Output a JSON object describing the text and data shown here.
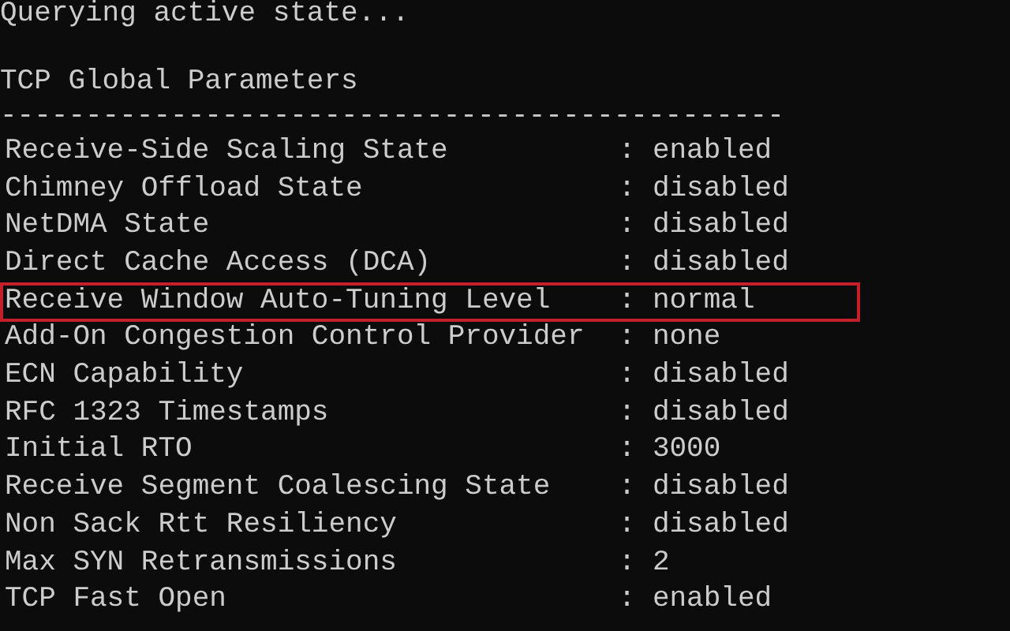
{
  "console": {
    "status_line": "Querying active state...",
    "heading": "TCP Global Parameters",
    "separator": "----------------------------------------------",
    "rows": [
      {
        "name": "Receive-Side Scaling State",
        "separator": ":",
        "value": "enabled",
        "highlighted": false
      },
      {
        "name": "Chimney Offload State",
        "separator": ":",
        "value": "disabled",
        "highlighted": false
      },
      {
        "name": "NetDMA State",
        "separator": ":",
        "value": "disabled",
        "highlighted": false
      },
      {
        "name": "Direct Cache Access (DCA)",
        "separator": ":",
        "value": "disabled",
        "highlighted": false
      },
      {
        "name": "Receive Window Auto-Tuning Level",
        "separator": ":",
        "value": "normal",
        "highlighted": true
      },
      {
        "name": "Add-On Congestion Control Provider",
        "separator": ":",
        "value": "none",
        "highlighted": false
      },
      {
        "name": "ECN Capability",
        "separator": ":",
        "value": "disabled",
        "highlighted": false
      },
      {
        "name": "RFC 1323 Timestamps",
        "separator": ":",
        "value": "disabled",
        "highlighted": false
      },
      {
        "name": "Initial RTO",
        "separator": ":",
        "value": "3000",
        "highlighted": false
      },
      {
        "name": "Receive Segment Coalescing State",
        "separator": ":",
        "value": "disabled",
        "highlighted": false
      },
      {
        "name": "Non Sack Rtt Resiliency",
        "separator": ":",
        "value": "disabled",
        "highlighted": false
      },
      {
        "name": "Max SYN Retransmissions",
        "separator": ":",
        "value": "2",
        "highlighted": false
      },
      {
        "name": "TCP Fast Open",
        "separator": ":",
        "value": "enabled",
        "highlighted": false
      }
    ]
  }
}
